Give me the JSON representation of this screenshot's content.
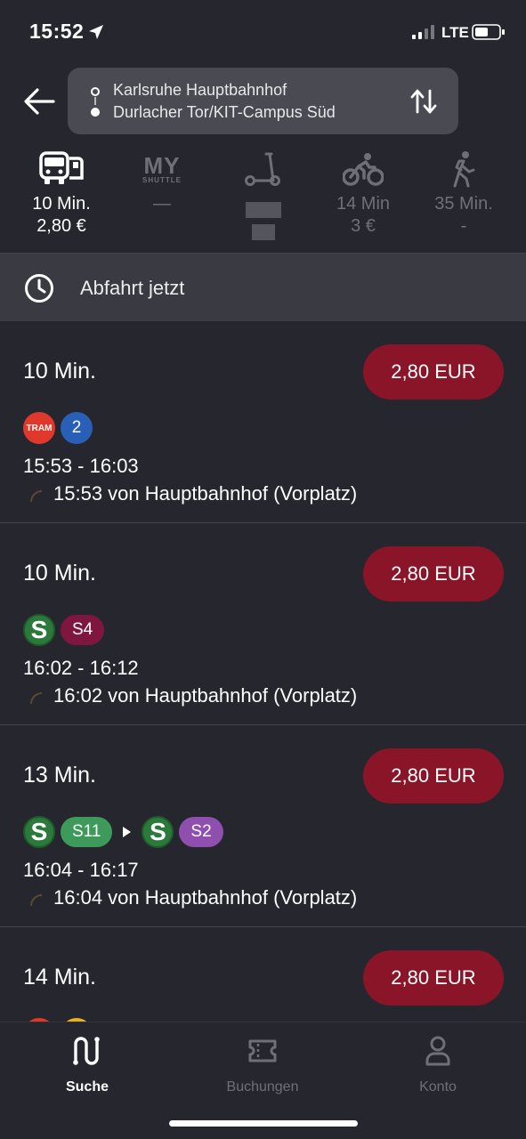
{
  "status_bar": {
    "time": "15:52",
    "network": "LTE"
  },
  "route": {
    "from": "Karlsruhe Hauptbahnhof",
    "to": "Durlacher Tor/KIT-Campus Süd"
  },
  "modes": [
    {
      "id": "public",
      "icon": "bus-icon",
      "line1": "10 Min.",
      "line2": "2,80 €"
    },
    {
      "id": "myshuttle",
      "icon": "myshuttle-logo",
      "logo_big": "MY",
      "logo_small": "SHUTTLE",
      "line1": "—",
      "line2": ""
    },
    {
      "id": "scooter",
      "icon": "scooter-icon",
      "line1": "",
      "line2": ""
    },
    {
      "id": "bike",
      "icon": "bike-icon",
      "line1": "14 Min",
      "line2": "3 €"
    },
    {
      "id": "walk",
      "icon": "walk-icon",
      "line1": "35 Min.",
      "line2": "-"
    }
  ],
  "departure": {
    "label": "Abfahrt jetzt"
  },
  "results": [
    {
      "duration": "10 Min.",
      "price": "2,80 EUR",
      "lines": [
        {
          "type": "tram",
          "label": "TRAM"
        },
        {
          "type": "circle",
          "label": "2",
          "color": "#2a5fb8"
        }
      ],
      "times": "15:53 - 16:03",
      "from": "15:53 von Hauptbahnhof (Vorplatz)"
    },
    {
      "duration": "10 Min.",
      "price": "2,80 EUR",
      "lines": [
        {
          "type": "s",
          "label": "S"
        },
        {
          "type": "pill",
          "label": "S4",
          "color": "#7f1640"
        }
      ],
      "times": "16:02 - 16:12",
      "from": "16:02 von Hauptbahnhof (Vorplatz)"
    },
    {
      "duration": "13 Min.",
      "price": "2,80 EUR",
      "lines": [
        {
          "type": "s",
          "label": "S"
        },
        {
          "type": "pill",
          "label": "S11",
          "color": "#3e9a5a"
        },
        {
          "type": "arrow"
        },
        {
          "type": "s",
          "label": "S"
        },
        {
          "type": "pill",
          "label": "S2",
          "color": "#8f4fae"
        }
      ],
      "times": "16:04 - 16:17",
      "from": "16:04 von Hauptbahnhof (Vorplatz)"
    },
    {
      "duration": "14 Min.",
      "price": "2,80 EUR",
      "lines": [],
      "times": "",
      "from": ""
    }
  ],
  "tabs": [
    {
      "label": "Suche",
      "icon": "route-icon",
      "active": true
    },
    {
      "label": "Buchungen",
      "icon": "ticket-icon",
      "active": false
    },
    {
      "label": "Konto",
      "icon": "person-icon",
      "active": false
    }
  ],
  "colors": {
    "background": "#26272e",
    "price_pill": "#8b1528",
    "bar": "#3a3b42",
    "muted": "#6f7077"
  }
}
